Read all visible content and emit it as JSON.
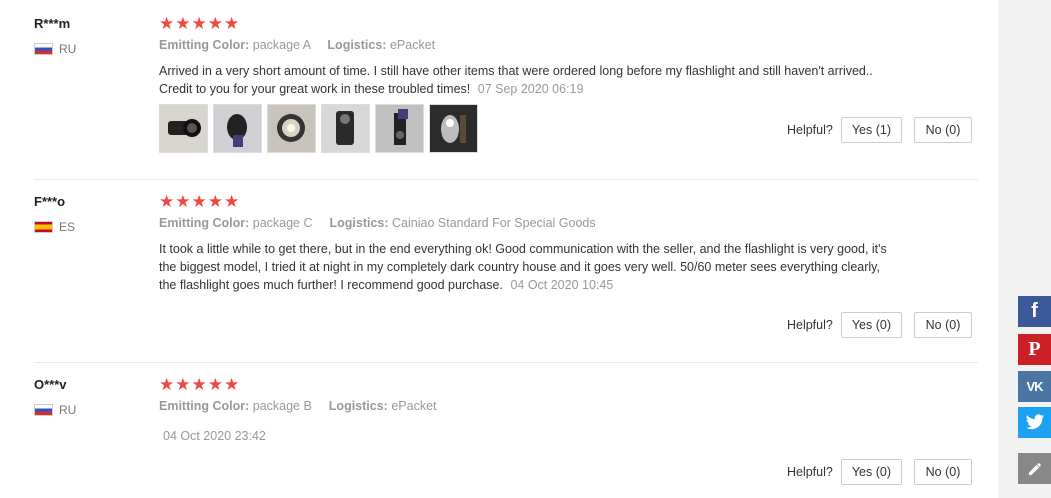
{
  "reviews": [
    {
      "user": "R***m",
      "country": "RU",
      "stars": "★★★★★",
      "color_label": "Emitting Color:",
      "color_value": "package A",
      "logistics_label": "Logistics:",
      "logistics_value": "ePacket",
      "text": "Arrived in a very short amount of time. I still have other items that were ordered long before my flashlight and still haven't arrived.. Credit to you for your great work in these troubled times!",
      "date": "07 Sep 2020 06:19",
      "helpful_label": "Helpful?",
      "yes_label": "Yes (1)",
      "no_label": "No (0)"
    },
    {
      "user": "F***o",
      "country": "ES",
      "stars": "★★★★★",
      "color_label": "Emitting Color:",
      "color_value": "package C",
      "logistics_label": "Logistics:",
      "logistics_value": "Cainiao Standard For Special Goods",
      "text": "It took a little while to get there, but in the end everything ok! Good communication with the seller, and the flashlight is very good, it's the biggest model, I tried it at night in my completely dark country house and it goes very well. 50/60 meter sees everything clearly, the flashlight goes much further! I recommend good purchase.",
      "date": "04 Oct 2020 10:45",
      "helpful_label": "Helpful?",
      "yes_label": "Yes (0)",
      "no_label": "No (0)"
    },
    {
      "user": "O***v",
      "country": "RU",
      "stars": "★★★★★",
      "color_label": "Emitting Color:",
      "color_value": "package B",
      "logistics_label": "Logistics:",
      "logistics_value": "ePacket",
      "date": "04 Oct 2020 23:42",
      "helpful_label": "Helpful?",
      "yes_label": "Yes (0)",
      "no_label": "No (0)"
    }
  ],
  "social": {
    "facebook": "f",
    "pinterest": "P",
    "vk": "VK",
    "twitter": "twitter-icon",
    "edit": "edit-icon",
    "colors": {
      "facebook": "#3b5998",
      "pinterest": "#cb2027",
      "vk": "#4c75a3",
      "twitter": "#1da1f2",
      "edit": "#888888"
    }
  },
  "accent": {
    "star": "#f04848"
  }
}
